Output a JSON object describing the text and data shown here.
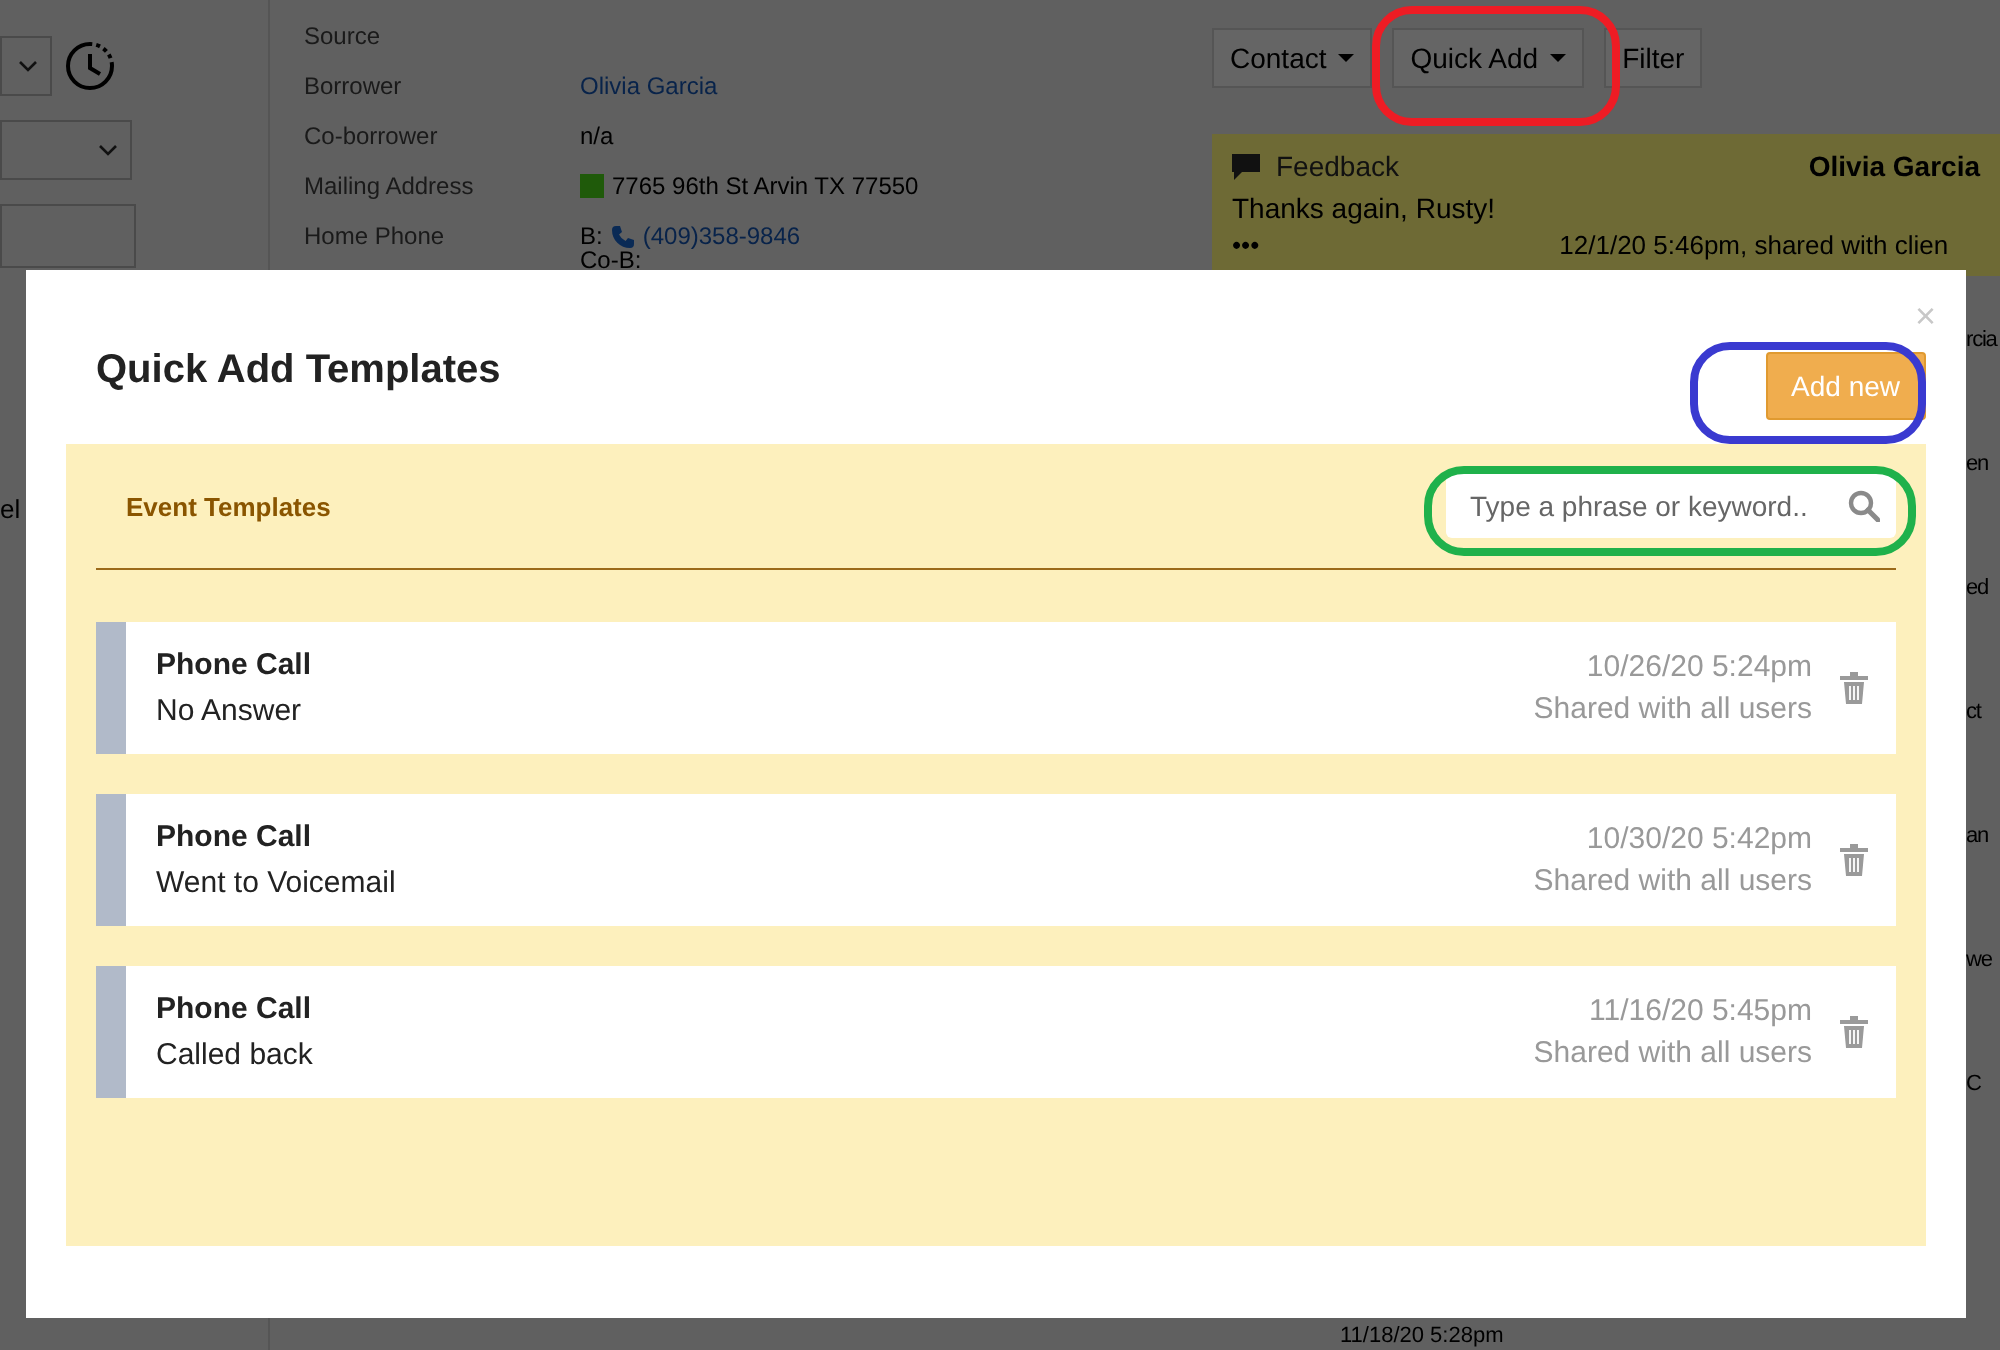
{
  "background": {
    "details": [
      {
        "label": "Source"
      },
      {
        "label": "Borrower",
        "value": "Olivia Garcia",
        "kind": "link"
      },
      {
        "label": "Co-borrower",
        "value": "n/a",
        "kind": "text"
      },
      {
        "label": "Mailing Address",
        "value": "7765 96th St Arvin TX 77550",
        "kind": "address"
      },
      {
        "label": "Home Phone",
        "value": "(409)358-9846",
        "prefix": "B:",
        "kind": "phone"
      }
    ],
    "co_b": "Co-B:",
    "left_fragment": "el",
    "toolbar": [
      {
        "label": "Contact",
        "dropdown": true
      },
      {
        "label": "Quick Add",
        "dropdown": true
      },
      {
        "label": "Filter",
        "dropdown": false
      }
    ],
    "feed_card": {
      "type": "Feedback",
      "author": "Olivia Garcia",
      "text": "Thanks again, Rusty!",
      "more": "•••",
      "meta": "12/1/20 5:46pm, shared with clien"
    },
    "right_fragments": [
      "rcia",
      "en",
      "ed",
      "ct",
      "an",
      "we",
      "C"
    ],
    "bottom_time": "11/18/20 5:28pm"
  },
  "modal": {
    "title": "Quick Add Templates",
    "close": "×",
    "add_button": "Add new",
    "section_title": "Event Templates",
    "search": {
      "placeholder": "Type a phrase or keyword.."
    },
    "templates": [
      {
        "type": "Phone Call",
        "name": "No Answer",
        "date": "10/26/20 5:24pm",
        "sharing": "Shared with all users"
      },
      {
        "type": "Phone Call",
        "name": "Went to Voicemail",
        "date": "10/30/20 5:42pm",
        "sharing": "Shared with all users"
      },
      {
        "type": "Phone Call",
        "name": "Called back",
        "date": "11/16/20 5:45pm",
        "sharing": "Shared with all users"
      }
    ]
  },
  "annotations": [
    {
      "color": "#ee1c24"
    },
    {
      "color": "#3a3ad0"
    },
    {
      "color": "#1fb14b"
    }
  ]
}
